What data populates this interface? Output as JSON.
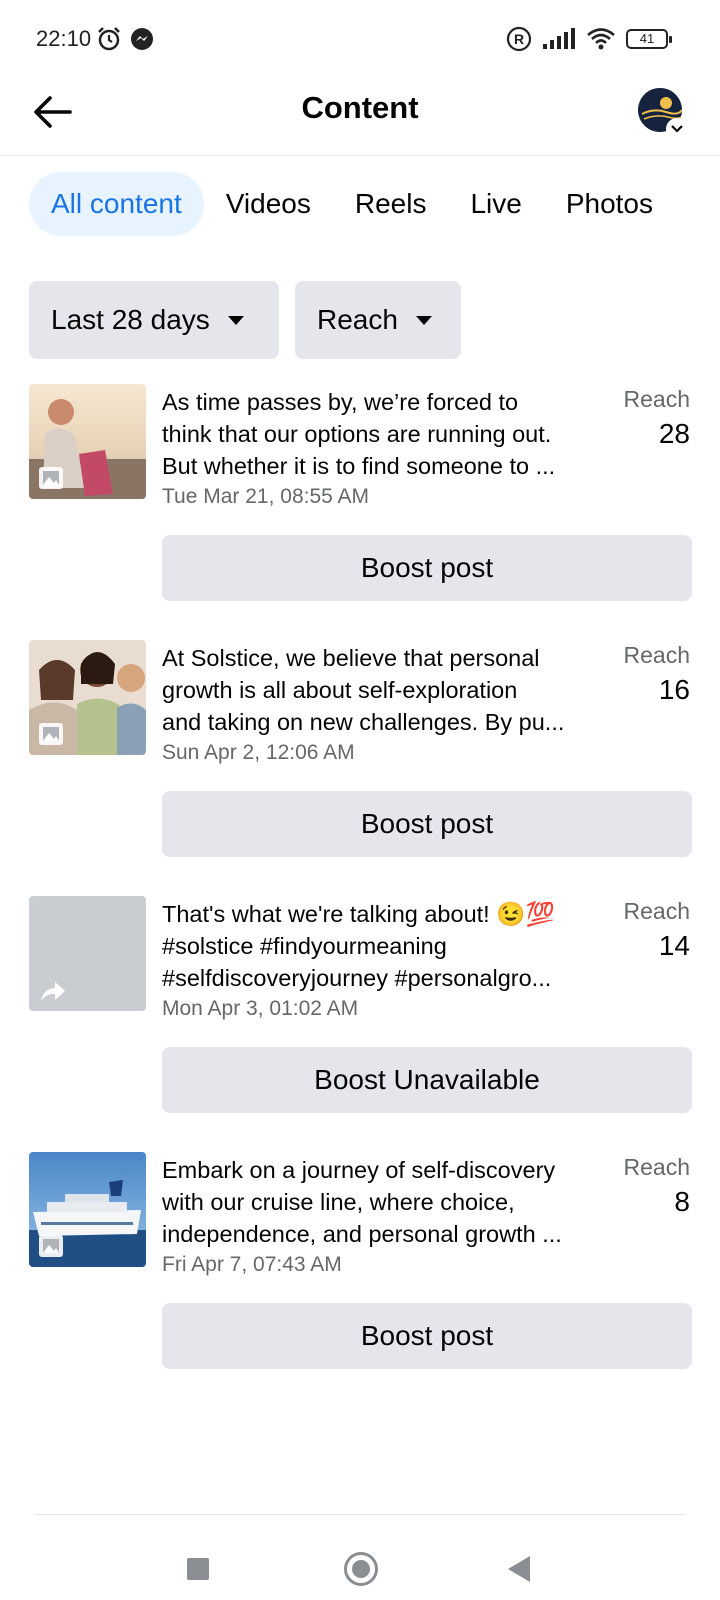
{
  "status_bar": {
    "time": "22:10",
    "battery": "41",
    "icons": [
      "alarm-icon",
      "messenger-icon",
      "registered-icon",
      "signal-icon",
      "wifi-icon",
      "battery-icon"
    ]
  },
  "header": {
    "title": "Content",
    "back_icon": "arrow-left-icon",
    "avatar_icon": "page-avatar-icon"
  },
  "tabs": [
    {
      "label": "All content",
      "active": true
    },
    {
      "label": "Videos",
      "active": false
    },
    {
      "label": "Reels",
      "active": false
    },
    {
      "label": "Live",
      "active": false
    },
    {
      "label": "Photos",
      "active": false
    }
  ],
  "filters": {
    "date_range": "Last 28 days",
    "metric": "Reach"
  },
  "posts": [
    {
      "lines": [
        "As time passes by, we’re forced to",
        "think that our options are running out.",
        "But whether it is to find someone to ..."
      ],
      "date": "Tue Mar 21, 08:55 AM",
      "reach_label": "Reach",
      "reach_value": "28",
      "action": "Boost post",
      "thumb_type": "photo",
      "thumb_icon": "photo-badge-icon"
    },
    {
      "lines": [
        "At Solstice, we believe that personal",
        "growth is all about self-exploration",
        "and taking on new challenges. By pu..."
      ],
      "date": "Sun Apr 2, 12:06 AM",
      "reach_label": "Reach",
      "reach_value": "16",
      "action": "Boost post",
      "thumb_type": "photo",
      "thumb_icon": "photo-badge-icon"
    },
    {
      "lines": [
        "That's what we're talking about! 😉💯",
        "#solstice #findyourmeaning",
        "#selfdiscoveryjourney #personalgro..."
      ],
      "date": "Mon Apr 3, 01:02 AM",
      "reach_label": "Reach",
      "reach_value": "14",
      "action": "Boost Unavailable",
      "thumb_type": "share",
      "thumb_icon": "share-arrow-icon"
    },
    {
      "lines": [
        "Embark on a journey of self-discovery",
        "with our cruise line, where choice,",
        "independence, and personal growth ..."
      ],
      "date": "Fri Apr 7, 07:43 AM",
      "reach_label": "Reach",
      "reach_value": "8",
      "action": "Boost post",
      "thumb_type": "photo",
      "thumb_icon": "photo-badge-icon"
    }
  ],
  "nav_bar": {
    "icons": [
      "recent-apps-icon",
      "home-icon",
      "back-triangle-icon"
    ]
  },
  "colors": {
    "accent": "#1b74e4",
    "tab_active_bg": "#e7f3ff",
    "button_bg": "#e4e6eb",
    "secondary_text": "#65676b"
  }
}
